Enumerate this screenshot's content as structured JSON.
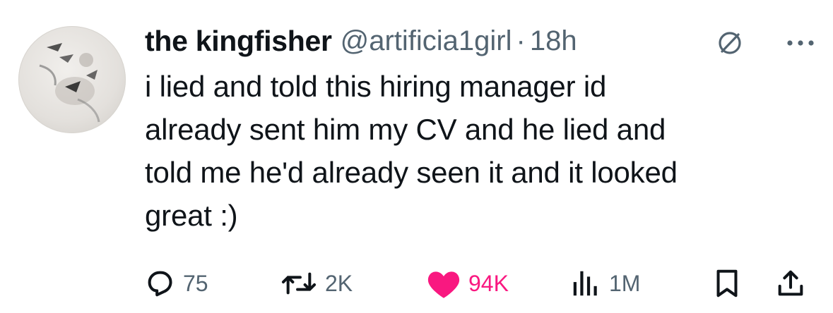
{
  "tweet": {
    "author": {
      "display_name": "the kingfisher",
      "handle": "@artificia1girl",
      "separator": "·",
      "time": "18h"
    },
    "text": "i lied and told this hiring manager id\nalready sent him my CV and he lied and\ntold me he'd already seen it and it looked\ngreat :)",
    "actions": {
      "replies": "75",
      "reposts": "2K",
      "likes": "94K",
      "views": "1M"
    }
  },
  "icons": {
    "reply": "reply-icon",
    "repost": "repost-icon",
    "like": "heart-icon",
    "views": "views-icon",
    "bookmark": "bookmark-icon",
    "share": "share-icon",
    "verified": "verified-icon",
    "more": "more-icon"
  },
  "colors": {
    "text": "#0f1419",
    "secondary": "#536471",
    "like": "#f91880"
  }
}
